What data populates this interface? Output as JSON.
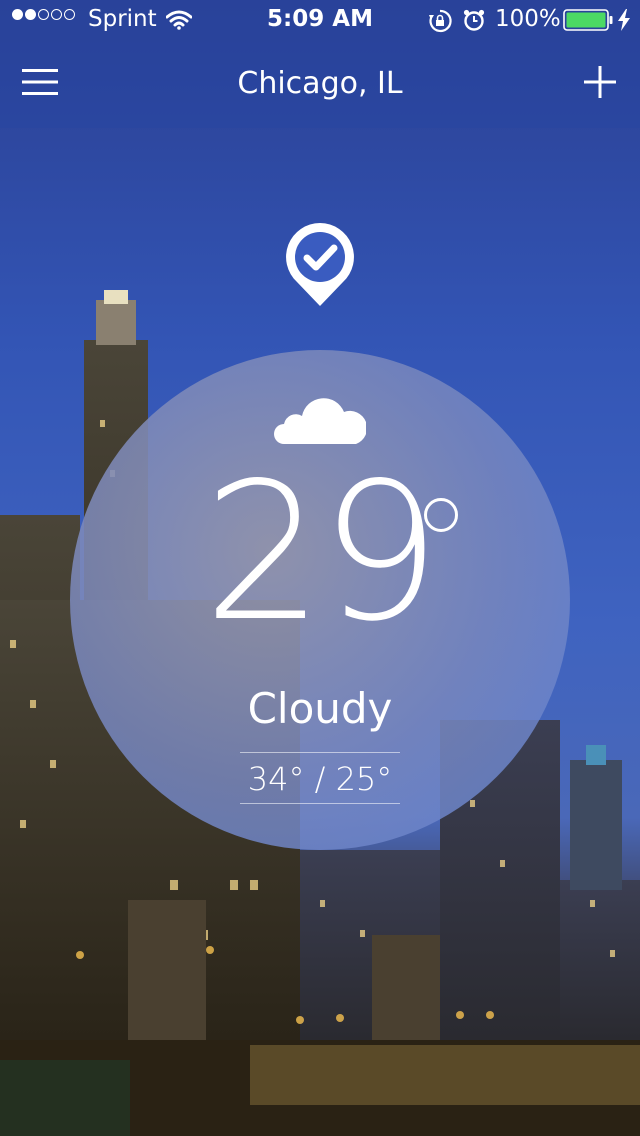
{
  "status_bar": {
    "signal_filled": 2,
    "signal_total": 5,
    "carrier": "Sprint",
    "time": "5:09 AM",
    "battery": "100%",
    "icons": [
      "wifi-icon",
      "rotation-lock-icon",
      "alarm-icon",
      "battery-icon",
      "charging-bolt-icon"
    ]
  },
  "header": {
    "title": "Chicago, IL",
    "menu_icon": "hamburger-menu-icon",
    "add_icon": "plus-icon"
  },
  "location_icon": "location-check-pin-icon",
  "weather": {
    "condition_icon": "cloud-icon",
    "temperature": "29",
    "condition": "Cloudy",
    "high_low": "34° / 25°"
  },
  "colors": {
    "accent": "#2f55b8",
    "battery": "#4cd964"
  }
}
